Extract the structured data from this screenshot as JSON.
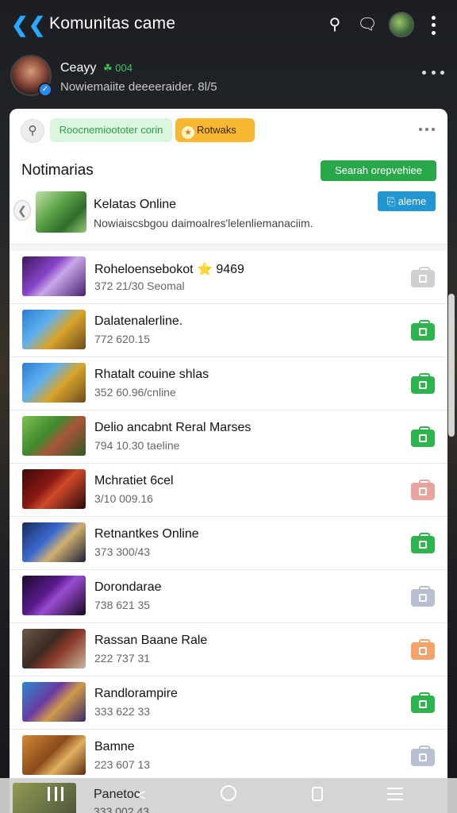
{
  "header": {
    "back_icon": "back-arrow-icon",
    "title": "Komunitas came",
    "icons": [
      "search-icon",
      "chat-icon",
      "avatar",
      "kebab-menu-icon"
    ]
  },
  "profile": {
    "name": "Ceayy",
    "badge": "☘ 004",
    "subtitle": "Nowiemaiite deeeeraider. 8l/5",
    "verified_icon": "verified-check-icon"
  },
  "filters": {
    "search_icon": "search-icon",
    "chip_green": "Roocnemioototer corin",
    "chip_orange": "Rotwaks",
    "more_icon": "more-horizontal-icon"
  },
  "section": {
    "title": "Notimarias",
    "action_label": "Searah orepvehiee"
  },
  "featured": {
    "title": "Kelatas Online",
    "description": "Nowiaiscsbgou daimoalres'lelenliemanaciim.",
    "action_label": "⎘ aleme"
  },
  "games": [
    {
      "title": "Roheloensebokot ⭐ 9469",
      "meta": "372  21/30  Seomal",
      "action_color": "#cfcfcf",
      "thumb": "purple"
    },
    {
      "title": "Dalatenalerline.",
      "meta": "772  620.15",
      "action_color": "#2eb34f",
      "thumb": "blue-gold"
    },
    {
      "title": "Rhatalt couine shlas",
      "meta": "352  60.96/cnline",
      "action_color": "#2eb34f",
      "thumb": "blue-gold"
    },
    {
      "title": "Delio ancabnt Reral Marses",
      "meta": "794  10.30  taeline",
      "action_color": "#2eb34f",
      "thumb": "green"
    },
    {
      "title": "Mchratiet 6cel",
      "meta": "3/10  009.16",
      "action_color": "#e8a5a0",
      "thumb": "red"
    },
    {
      "title": "Retnantkes Online",
      "meta": "373  300/43",
      "action_color": "#2eb34f",
      "thumb": "storm"
    },
    {
      "title": "Dorondarae",
      "meta": "738  621 35",
      "action_color": "#b7bfd0",
      "thumb": "violet"
    },
    {
      "title": "Rassan Baane Rale",
      "meta": "222  737 31",
      "action_color": "#f4a36b",
      "thumb": "brown"
    },
    {
      "title": "Randlorampire",
      "meta": "333  622 33",
      "action_color": "#2eb34f",
      "thumb": "blue-purple"
    },
    {
      "title": "Bamne",
      "meta": "223  607 13",
      "action_color": "#b7bfd0",
      "thumb": "orange"
    }
  ],
  "navbar": {
    "peek_title": "Panetoc",
    "peek_meta": "333  002.43",
    "icons": [
      "recent-apps-icon",
      "back-nav-icon",
      "home-icon",
      "overview-icon",
      "menu-icon"
    ]
  }
}
